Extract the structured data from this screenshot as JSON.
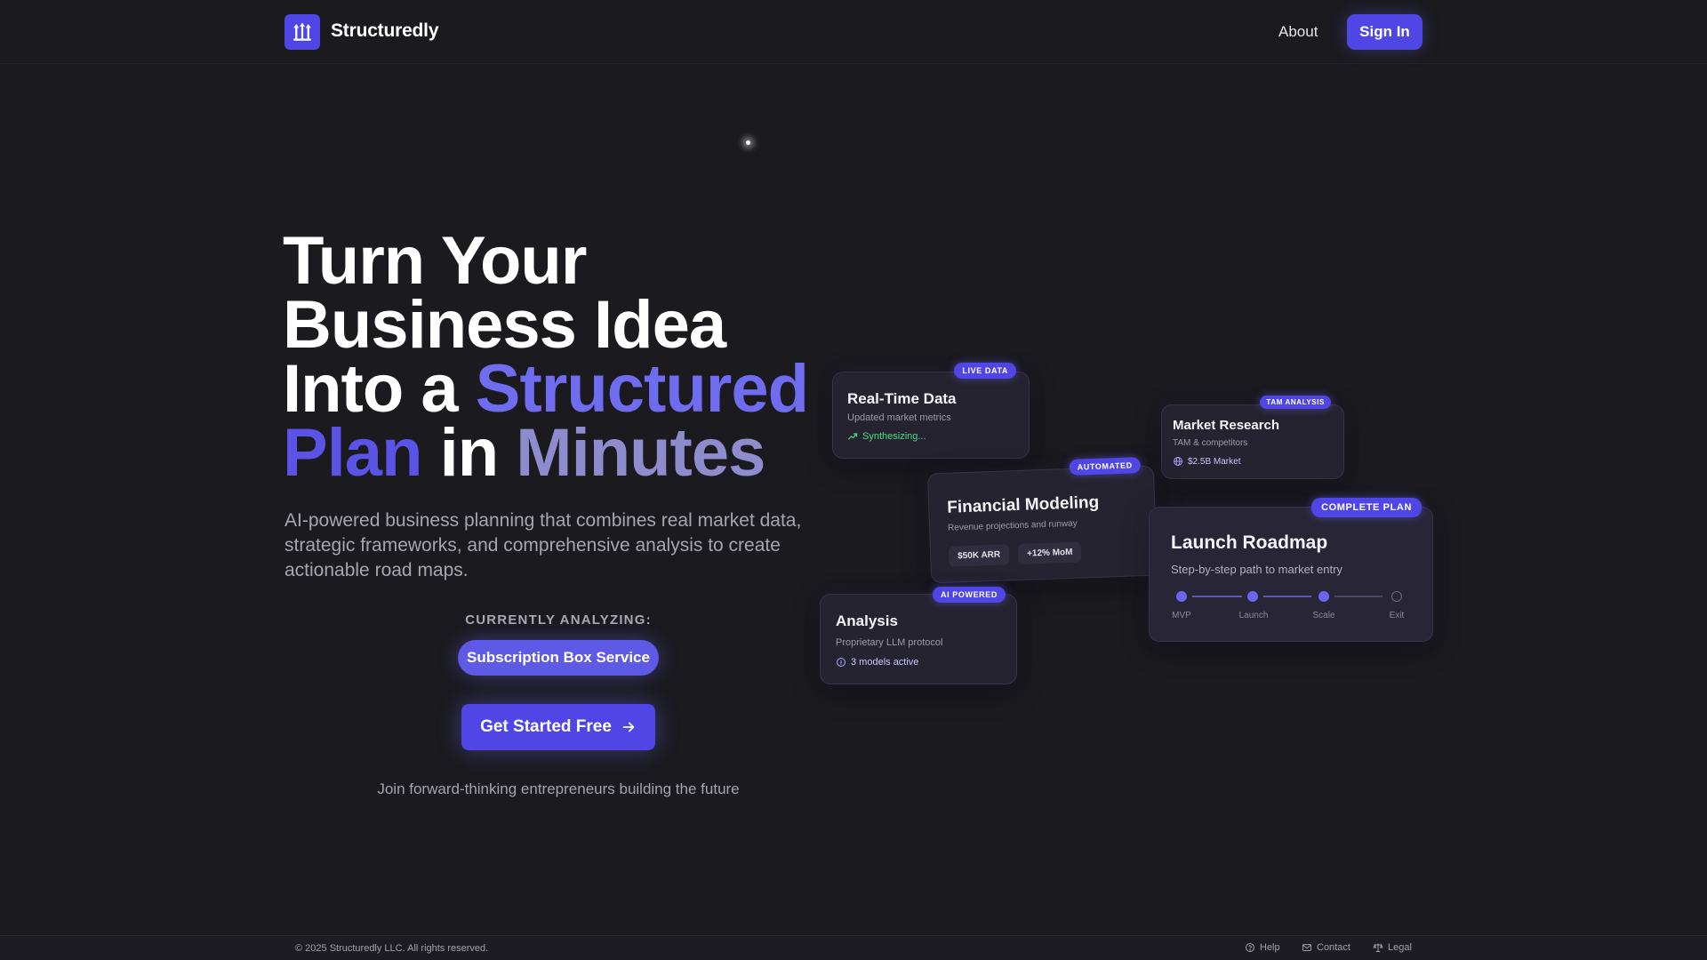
{
  "header": {
    "brand": "Structuredly",
    "nav_about": "About",
    "sign_in": "Sign In"
  },
  "hero": {
    "title_l1": "Turn Your",
    "title_l2": "Business Idea",
    "title_l3a": "Into a ",
    "title_l3b": "Structured",
    "title_l4a": "Plan",
    "title_l4b": " in ",
    "title_l4c": "Minutes",
    "subtitle": "AI-powered business planning that combines real market data, strategic frameworks, and comprehensive analysis to create actionable road maps.",
    "analyzing_label": "CURRENTLY ANALYZING:",
    "analyzing_value": "Subscription Box Service",
    "cta": "Get Started Free",
    "join": "Join forward-thinking entrepreneurs building the future"
  },
  "cards": {
    "realtime": {
      "badge": "LIVE DATA",
      "title": "Real-Time Data",
      "desc": "Updated market metrics",
      "foot": "Synthesizing..."
    },
    "market": {
      "badge": "TAM ANALYSIS",
      "title": "Market Research",
      "desc": "TAM & competitors",
      "foot": "$2.5B Market"
    },
    "financial": {
      "badge": "AUTOMATED",
      "title": "Financial Modeling",
      "desc": "Revenue projections and runway",
      "chip1": "$50K ARR",
      "chip2": "+12% MoM"
    },
    "roadmap": {
      "badge": "COMPLETE PLAN",
      "title": "Launch Roadmap",
      "desc": "Step-by-step path to market entry",
      "steps": [
        "MVP",
        "Launch",
        "Scale",
        "Exit"
      ]
    },
    "analysis": {
      "badge": "AI POWERED",
      "title": "Analysis",
      "desc": "Proprietary LLM protocol",
      "foot": "3 models active"
    }
  },
  "footer": {
    "copyright": "© 2025 Structuredly LLC. All rights reserved.",
    "help": "Help",
    "contact": "Contact",
    "legal": "Legal"
  },
  "colors": {
    "background": "#1b1a1f",
    "accent": "#4f46e5",
    "accent_light": "#6f6cf0",
    "positive": "#4ade80"
  }
}
